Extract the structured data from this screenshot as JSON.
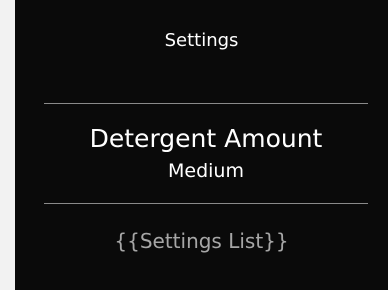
{
  "header": {
    "title": "Settings"
  },
  "selected_setting": {
    "name": "Detergent Amount",
    "value": "Medium"
  },
  "settings_list": {
    "placeholder_text": "{{Settings List}}"
  },
  "colors": {
    "screen_background": "#0a0a0a",
    "divider": "#8a8a8a",
    "primary_text": "#ffffff",
    "placeholder_text": "#a6a6a6"
  }
}
